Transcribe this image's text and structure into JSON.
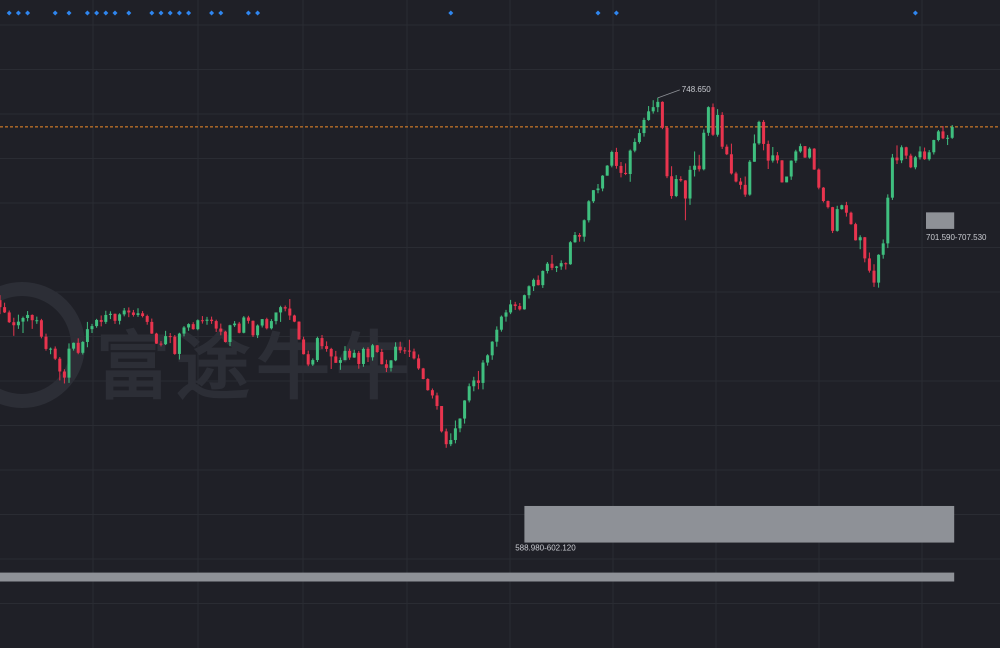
{
  "watermark": "富途牛牛",
  "colors": {
    "background": "#1f2027",
    "grid": "#2a2c33",
    "up": "#3fbf7f",
    "down": "#e8344e",
    "zone": "#8e9197",
    "price_line": "#f08c28",
    "signal": "#2f86ef"
  },
  "chart_data": {
    "type": "candlestick",
    "ylim": [
      554,
      773
    ],
    "grid": true,
    "annotations": {
      "high_label": "748.650",
      "high_value": 748.65,
      "upper_zone_label": "701.590-707.530",
      "upper_zone_range": [
        701.59,
        707.53
      ],
      "middle_zone_label": "588.980-602.120",
      "middle_zone_range": [
        588.98,
        602.12
      ],
      "bottom_zone_range": [
        575.0,
        578.2
      ],
      "current_price_line": 738.2
    },
    "signal_markers": [
      2,
      4,
      6,
      12,
      15,
      19,
      21,
      23,
      25,
      28,
      33,
      35,
      37,
      39,
      41,
      46,
      48,
      54,
      56,
      98,
      130,
      134,
      199,
      230,
      234,
      245
    ],
    "ohlc": [
      [
        676.0,
        677.8,
        671.0,
        673.5
      ],
      [
        673.5,
        675.1,
        671.4,
        671.6
      ],
      [
        671.6,
        672.3,
        667.8,
        668.1
      ],
      [
        668.1,
        669.7,
        663.2,
        667.0
      ],
      [
        667.0,
        670.8,
        665.7,
        668.3
      ],
      [
        668.3,
        670.1,
        664.2,
        669.6
      ],
      [
        669.6,
        672.1,
        668.4,
        670.7
      ],
      [
        670.7,
        670.9,
        665.7,
        668.8
      ],
      [
        668.8,
        670.1,
        667.5,
        668.8
      ],
      [
        668.8,
        669.3,
        662.3,
        662.9
      ],
      [
        662.9,
        664.0,
        657.9,
        658.5
      ],
      [
        658.5,
        659.0,
        656.6,
        658.6
      ],
      [
        658.6,
        659.4,
        654.5,
        655.0
      ],
      [
        655.0,
        655.6,
        647.2,
        650.4
      ],
      [
        650.4,
        651.2,
        646.1,
        648.2
      ],
      [
        648.2,
        660.5,
        646.3,
        658.6
      ],
      [
        658.6,
        660.8,
        657.9,
        660.7
      ],
      [
        660.7,
        662.3,
        656.6,
        657.1
      ],
      [
        657.1,
        661.3,
        656.5,
        661.0
      ],
      [
        661.0,
        668.2,
        659.1,
        665.6
      ],
      [
        665.6,
        667.5,
        664.2,
        666.7
      ],
      [
        666.7,
        669.3,
        666.1,
        668.9
      ],
      [
        668.9,
        670.5,
        666.6,
        668.2
      ],
      [
        668.2,
        672.2,
        667.5,
        670.7
      ],
      [
        670.7,
        672.0,
        669.2,
        671.1
      ],
      [
        671.1,
        671.2,
        667.5,
        668.6
      ],
      [
        668.6,
        671.3,
        667.3,
        670.9
      ],
      [
        670.9,
        673.2,
        670.2,
        672.3
      ],
      [
        672.3,
        673.4,
        669.9,
        671.6
      ],
      [
        671.6,
        672.5,
        670.1,
        670.7
      ],
      [
        670.7,
        673.1,
        670.0,
        671.3
      ],
      [
        671.3,
        672.1,
        669.8,
        670.3
      ],
      [
        670.3,
        670.8,
        667.2,
        668.2
      ],
      [
        668.2,
        669.4,
        663.9,
        664.0
      ],
      [
        664.0,
        664.3,
        660.3,
        660.4
      ],
      [
        660.4,
        661.3,
        659.4,
        660.2
      ],
      [
        660.2,
        665.0,
        659.9,
        663.1
      ],
      [
        663.1,
        664.2,
        660.6,
        662.9
      ],
      [
        662.9,
        663.5,
        656.4,
        656.7
      ],
      [
        656.7,
        664.3,
        654.7,
        664.0
      ],
      [
        664.0,
        666.7,
        663.0,
        666.2
      ],
      [
        666.2,
        667.7,
        665.0,
        667.4
      ],
      [
        667.4,
        668.1,
        665.4,
        665.6
      ],
      [
        665.6,
        669.1,
        665.2,
        668.8
      ],
      [
        668.8,
        670.3,
        667.6,
        668.6
      ],
      [
        668.6,
        670.0,
        667.2,
        669.0
      ],
      [
        669.0,
        670.1,
        667.5,
        668.5
      ],
      [
        668.5,
        669.0,
        664.6,
        665.8
      ],
      [
        665.8,
        667.6,
        663.4,
        664.7
      ],
      [
        664.7,
        665.0,
        660.8,
        661.0
      ],
      [
        661.0,
        667.2,
        659.5,
        667.0
      ],
      [
        667.0,
        668.5,
        666.4,
        667.6
      ],
      [
        667.6,
        668.2,
        664.1,
        664.3
      ],
      [
        664.3,
        670.3,
        664.1,
        669.8
      ],
      [
        669.8,
        670.4,
        667.6,
        668.6
      ],
      [
        668.6,
        668.7,
        662.8,
        663.4
      ],
      [
        663.4,
        667.3,
        662.4,
        666.9
      ],
      [
        666.9,
        669.2,
        666.2,
        669.2
      ],
      [
        669.2,
        669.7,
        665.5,
        665.9
      ],
      [
        665.9,
        669.2,
        665.5,
        668.5
      ],
      [
        668.5,
        671.6,
        667.3,
        671.6
      ],
      [
        671.6,
        674.0,
        668.2,
        673.5
      ],
      [
        673.5,
        674.1,
        672.0,
        673.0
      ],
      [
        673.0,
        676.4,
        668.9,
        670.5
      ],
      [
        670.5,
        670.8,
        668.1,
        668.3
      ],
      [
        668.3,
        668.4,
        661.8,
        661.9
      ],
      [
        661.9,
        662.9,
        656.5,
        656.6
      ],
      [
        656.6,
        657.9,
        652.3,
        652.9
      ],
      [
        652.9,
        655.1,
        652.4,
        654.5
      ],
      [
        654.5,
        662.9,
        653.8,
        662.4
      ],
      [
        662.4,
        663.5,
        658.5,
        659.5
      ],
      [
        659.5,
        661.2,
        657.5,
        658.5
      ],
      [
        658.5,
        658.9,
        651.3,
        655.8
      ],
      [
        655.8,
        657.8,
        653.5,
        653.5
      ],
      [
        653.5,
        655.4,
        651.0,
        654.5
      ],
      [
        654.5,
        659.5,
        654.4,
        657.8
      ],
      [
        657.8,
        658.6,
        654.6,
        655.4
      ],
      [
        655.4,
        658.2,
        655.3,
        657.1
      ],
      [
        657.1,
        657.8,
        651.4,
        653.1
      ],
      [
        653.1,
        659.0,
        652.1,
        658.5
      ],
      [
        658.5,
        659.1,
        653.8,
        655.5
      ],
      [
        655.5,
        660.3,
        654.3,
        659.8
      ],
      [
        659.8,
        659.9,
        657.1,
        657.4
      ],
      [
        657.4,
        658.5,
        652.9,
        653.0
      ],
      [
        653.0,
        654.6,
        650.2,
        651.7
      ],
      [
        651.7,
        654.5,
        650.4,
        654.4
      ],
      [
        654.4,
        660.9,
        654.1,
        659.3
      ],
      [
        659.3,
        661.1,
        657.0,
        658.0
      ],
      [
        658.0,
        659.1,
        656.7,
        657.9
      ],
      [
        657.9,
        661.8,
        655.6,
        657.6
      ],
      [
        657.6,
        658.6,
        654.7,
        655.1
      ],
      [
        655.1,
        656.5,
        651.0,
        651.5
      ],
      [
        651.5,
        651.7,
        647.6,
        647.7
      ],
      [
        647.7,
        648.0,
        643.5,
        643.7
      ],
      [
        643.7,
        644.3,
        640.7,
        641.8
      ],
      [
        641.8,
        642.8,
        636.7,
        638.0
      ],
      [
        638.0,
        638.0,
        628.5,
        628.9
      ],
      [
        628.9,
        629.9,
        623.0,
        624.3
      ],
      [
        624.3,
        628.2,
        623.6,
        625.8
      ],
      [
        625.8,
        632.8,
        624.6,
        630.0
      ],
      [
        630.0,
        633.6,
        628.6,
        633.5
      ],
      [
        633.5,
        640.1,
        631.7,
        640.0
      ],
      [
        640.0,
        646.1,
        639.3,
        645.1
      ],
      [
        645.1,
        648.5,
        643.3,
        647.2
      ],
      [
        647.2,
        650.6,
        644.0,
        646.3
      ],
      [
        646.3,
        654.5,
        644.0,
        653.6
      ],
      [
        653.6,
        656.6,
        652.5,
        656.2
      ],
      [
        656.2,
        661.3,
        654.6,
        661.1
      ],
      [
        661.1,
        666.6,
        659.3,
        665.4
      ],
      [
        665.4,
        670.5,
        664.7,
        670.1
      ],
      [
        670.1,
        672.5,
        668.3,
        671.6
      ],
      [
        671.6,
        676.1,
        671.0,
        674.5
      ],
      [
        674.5,
        675.4,
        672.5,
        673.9
      ],
      [
        673.9,
        675.0,
        672.3,
        672.7
      ],
      [
        672.7,
        678.0,
        672.6,
        677.8
      ],
      [
        677.8,
        681.3,
        676.6,
        681.0
      ],
      [
        681.0,
        683.8,
        679.3,
        683.3
      ],
      [
        683.3,
        684.9,
        681.3,
        681.4
      ],
      [
        681.4,
        686.7,
        680.4,
        686.5
      ],
      [
        686.5,
        689.7,
        685.6,
        689.1
      ],
      [
        689.1,
        692.2,
        686.8,
        687.6
      ],
      [
        687.6,
        688.3,
        686.1,
        688.1
      ],
      [
        688.1,
        690.3,
        686.9,
        689.3
      ],
      [
        689.3,
        689.6,
        687.0,
        688.9
      ],
      [
        688.9,
        697.2,
        688.7,
        696.8
      ],
      [
        696.8,
        700.5,
        696.6,
        699.4
      ],
      [
        699.4,
        700.1,
        697.0,
        698.8
      ],
      [
        698.8,
        705.0,
        697.0,
        704.7
      ],
      [
        704.7,
        711.9,
        703.9,
        711.5
      ],
      [
        711.5,
        715.5,
        710.9,
        715.5
      ],
      [
        715.5,
        717.7,
        714.4,
        716.1
      ],
      [
        716.1,
        720.9,
        715.1,
        720.7
      ],
      [
        720.7,
        724.5,
        720.7,
        724.3
      ],
      [
        724.3,
        729.7,
        723.7,
        729.2
      ],
      [
        729.2,
        730.7,
        723.2,
        724.2
      ],
      [
        724.2,
        725.6,
        720.1,
        721.7
      ],
      [
        721.7,
        725.1,
        720.9,
        721.3
      ],
      [
        721.3,
        730.1,
        718.5,
        729.7
      ],
      [
        729.7,
        734.1,
        729.1,
        732.8
      ],
      [
        732.8,
        737.4,
        732.2,
        736.0
      ],
      [
        736.0,
        741.5,
        734.7,
        740.7
      ],
      [
        740.7,
        745.7,
        740.4,
        743.8
      ],
      [
        743.8,
        747.8,
        743.0,
        745.3
      ],
      [
        745.3,
        748.7,
        743.5,
        747.2
      ],
      [
        747.2,
        747.4,
        737.4,
        737.9
      ],
      [
        737.9,
        738.5,
        719.8,
        720.5
      ],
      [
        720.5,
        724.1,
        712.4,
        713.4
      ],
      [
        713.4,
        720.9,
        713.0,
        719.5
      ],
      [
        719.5,
        720.5,
        718.5,
        719.0
      ],
      [
        719.0,
        719.1,
        704.7,
        712.5
      ],
      [
        712.5,
        724.2,
        710.2,
        722.8
      ],
      [
        722.8,
        729.4,
        720.4,
        724.3
      ],
      [
        724.3,
        728.2,
        722.2,
        723.0
      ],
      [
        723.0,
        737.3,
        722.6,
        736.1
      ],
      [
        736.1,
        745.6,
        735.0,
        745.3
      ],
      [
        745.3,
        746.6,
        735.0,
        735.4
      ],
      [
        735.4,
        744.6,
        734.7,
        742.5
      ],
      [
        742.5,
        743.5,
        730.3,
        731.1
      ],
      [
        731.1,
        731.9,
        728.1,
        728.4
      ],
      [
        728.4,
        732.2,
        721.1,
        721.5
      ],
      [
        721.5,
        722.1,
        718.3,
        718.6
      ],
      [
        718.6,
        719.9,
        715.8,
        717.4
      ],
      [
        717.4,
        720.4,
        713.1,
        713.9
      ],
      [
        713.9,
        726.3,
        713.5,
        725.7
      ],
      [
        725.7,
        735.5,
        725.7,
        732.3
      ],
      [
        732.3,
        740.4,
        731.8,
        740.0
      ],
      [
        740.0,
        740.7,
        729.8,
        732.1
      ],
      [
        732.1,
        733.3,
        723.1,
        726.1
      ],
      [
        726.1,
        731.0,
        725.4,
        728.0
      ],
      [
        728.0,
        729.2,
        725.1,
        726.2
      ],
      [
        726.2,
        726.3,
        718.2,
        718.3
      ],
      [
        718.3,
        719.0,
        720.6,
        720.4
      ],
      [
        720.4,
        726.2,
        719.2,
        726.1
      ],
      [
        726.1,
        730.0,
        725.3,
        729.4
      ],
      [
        729.4,
        732.2,
        728.9,
        731.3
      ],
      [
        731.3,
        731.3,
        727.1,
        727.2
      ],
      [
        727.2,
        730.9,
        726.8,
        730.4
      ],
      [
        730.4,
        730.6,
        722.8,
        722.9
      ],
      [
        722.9,
        723.3,
        715.8,
        716.4
      ],
      [
        716.4,
        716.6,
        711.1,
        711.6
      ],
      [
        711.6,
        711.8,
        708.9,
        709.4
      ],
      [
        709.4,
        709.5,
        700.1,
        700.9
      ],
      [
        700.9,
        709.9,
        700.6,
        708.7
      ],
      [
        708.7,
        710.3,
        708.5,
        710.1
      ],
      [
        710.1,
        711.3,
        706.0,
        707.4
      ],
      [
        707.4,
        707.8,
        703.1,
        703.3
      ],
      [
        703.3,
        703.8,
        697.4,
        697.5
      ],
      [
        697.5,
        699.3,
        694.3,
        698.6
      ],
      [
        698.6,
        698.7,
        689.6,
        691.0
      ],
      [
        691.0,
        693.1,
        685.9,
        686.6
      ],
      [
        686.6,
        688.9,
        680.8,
        682.3
      ],
      [
        682.3,
        692.5,
        680.5,
        692.3
      ],
      [
        692.3,
        697.8,
        690.9,
        696.4
      ],
      [
        696.4,
        714.0,
        694.7,
        712.8
      ],
      [
        712.8,
        728.5,
        712.0,
        727.2
      ],
      [
        727.2,
        731.6,
        724.9,
        726.2
      ],
      [
        726.2,
        731.6,
        725.2,
        730.9
      ],
      [
        730.9,
        731.1,
        726.7,
        727.9
      ],
      [
        727.9,
        728.6,
        723.4,
        723.7
      ],
      [
        723.7,
        727.8,
        723.0,
        727.3
      ],
      [
        727.3,
        731.2,
        726.5,
        729.4
      ],
      [
        729.4,
        730.8,
        726.4,
        726.6
      ],
      [
        726.6,
        729.9,
        726.1,
        729.1
      ],
      [
        729.1,
        733.6,
        728.3,
        733.5
      ],
      [
        733.5,
        737.1,
        733.0,
        736.6
      ],
      [
        736.6,
        738.5,
        733.8,
        734.1
      ],
      [
        734.1,
        735.3,
        731.7,
        734.3
      ],
      [
        734.3,
        738.9,
        733.9,
        738.2
      ]
    ]
  }
}
